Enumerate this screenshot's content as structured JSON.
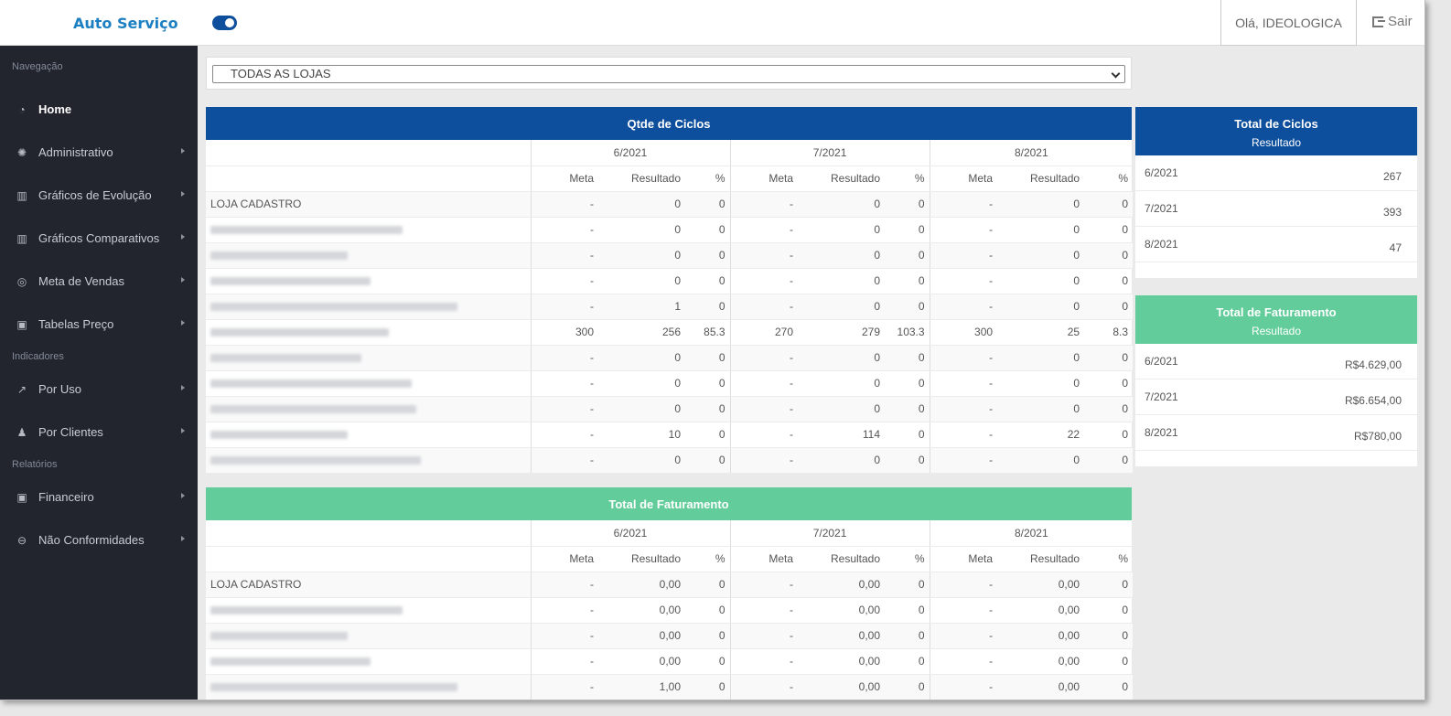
{
  "header": {
    "brand": "Auto Serviço",
    "greeting": "Olá, IDEOLOGICA",
    "logout": "Sair"
  },
  "sidebar": {
    "sections": [
      {
        "label": "Navegação",
        "items": [
          {
            "label": "Home",
            "icon": "dashboard-icon",
            "active": true,
            "arrow": false
          },
          {
            "label": "Administrativo",
            "icon": "gear-icon",
            "arrow": true
          },
          {
            "label": "Gráficos de Evolução",
            "icon": "bar-chart-icon",
            "arrow": true
          },
          {
            "label": "Gráficos Comparativos",
            "icon": "bar-chart-icon",
            "arrow": true
          },
          {
            "label": "Meta de Vendas",
            "icon": "target-icon",
            "arrow": true
          },
          {
            "label": "Tabelas Preço",
            "icon": "money-icon",
            "arrow": true
          }
        ]
      },
      {
        "label": "Indicadores",
        "items": [
          {
            "label": "Por Uso",
            "icon": "line-chart-icon",
            "arrow": true
          },
          {
            "label": "Por Clientes",
            "icon": "users-icon",
            "arrow": true
          }
        ]
      },
      {
        "label": "Relatórios",
        "items": [
          {
            "label": "Financeiro",
            "icon": "money-icon",
            "arrow": true
          },
          {
            "label": "Não Conformidades",
            "icon": "minus-circle-icon",
            "arrow": true
          }
        ]
      }
    ]
  },
  "filter": {
    "selected": "TODAS AS LOJAS"
  },
  "ciclos_table": {
    "title": "Qtde de Ciclos",
    "months": [
      "6/2021",
      "7/2021",
      "8/2021"
    ],
    "subheaders": [
      "Meta",
      "Resultado",
      "%"
    ],
    "rows": [
      {
        "name": "LOJA CADASTRO",
        "values": [
          "-",
          "0",
          "0",
          "-",
          "0",
          "0",
          "-",
          "0",
          "0"
        ]
      },
      {
        "name": "",
        "values": [
          "-",
          "0",
          "0",
          "-",
          "0",
          "0",
          "-",
          "0",
          "0"
        ]
      },
      {
        "name": "",
        "values": [
          "-",
          "0",
          "0",
          "-",
          "0",
          "0",
          "-",
          "0",
          "0"
        ]
      },
      {
        "name": "",
        "values": [
          "-",
          "0",
          "0",
          "-",
          "0",
          "0",
          "-",
          "0",
          "0"
        ]
      },
      {
        "name": "",
        "values": [
          "-",
          "1",
          "0",
          "-",
          "0",
          "0",
          "-",
          "0",
          "0"
        ]
      },
      {
        "name": "",
        "values": [
          "300",
          "256",
          "85.3",
          "270",
          "279",
          "103.3",
          "300",
          "25",
          "8.3"
        ]
      },
      {
        "name": "",
        "values": [
          "-",
          "0",
          "0",
          "-",
          "0",
          "0",
          "-",
          "0",
          "0"
        ]
      },
      {
        "name": "",
        "values": [
          "-",
          "0",
          "0",
          "-",
          "0",
          "0",
          "-",
          "0",
          "0"
        ]
      },
      {
        "name": "",
        "values": [
          "-",
          "0",
          "0",
          "-",
          "0",
          "0",
          "-",
          "0",
          "0"
        ]
      },
      {
        "name": "",
        "values": [
          "-",
          "10",
          "0",
          "-",
          "114",
          "0",
          "-",
          "22",
          "0"
        ]
      },
      {
        "name": "",
        "values": [
          "-",
          "0",
          "0",
          "-",
          "0",
          "0",
          "-",
          "0",
          "0"
        ]
      }
    ]
  },
  "faturamento_table": {
    "title": "Total de Faturamento",
    "months": [
      "6/2021",
      "7/2021",
      "8/2021"
    ],
    "subheaders": [
      "Meta",
      "Resultado",
      "%"
    ],
    "rows": [
      {
        "name": "LOJA CADASTRO",
        "values": [
          "-",
          "0,00",
          "0",
          "-",
          "0,00",
          "0",
          "-",
          "0,00",
          "0"
        ]
      },
      {
        "name": "",
        "values": [
          "-",
          "0,00",
          "0",
          "-",
          "0,00",
          "0",
          "-",
          "0,00",
          "0"
        ]
      },
      {
        "name": "",
        "values": [
          "-",
          "0,00",
          "0",
          "-",
          "0,00",
          "0",
          "-",
          "0,00",
          "0"
        ]
      },
      {
        "name": "",
        "values": [
          "-",
          "0,00",
          "0",
          "-",
          "0,00",
          "0",
          "-",
          "0,00",
          "0"
        ]
      },
      {
        "name": "",
        "values": [
          "-",
          "1,00",
          "0",
          "-",
          "0,00",
          "0",
          "-",
          "0,00",
          "0"
        ]
      }
    ]
  },
  "total_ciclos_card": {
    "title": "Total de Ciclos",
    "subtitle": "Resultado",
    "rows": [
      {
        "label": "6/2021",
        "value": "267"
      },
      {
        "label": "7/2021",
        "value": "393"
      },
      {
        "label": "8/2021",
        "value": "47"
      }
    ]
  },
  "total_faturamento_card": {
    "title": "Total de Faturamento",
    "subtitle": "Resultado",
    "rows": [
      {
        "label": "6/2021",
        "value": "R$4.629,00"
      },
      {
        "label": "7/2021",
        "value": "R$6.654,00"
      },
      {
        "label": "8/2021",
        "value": "R$780,00"
      }
    ]
  },
  "colors": {
    "primary_blue": "#0d4f9c",
    "green": "#62cd9a",
    "sidebar_bg": "#22252e",
    "brand": "#1c7fc2"
  }
}
